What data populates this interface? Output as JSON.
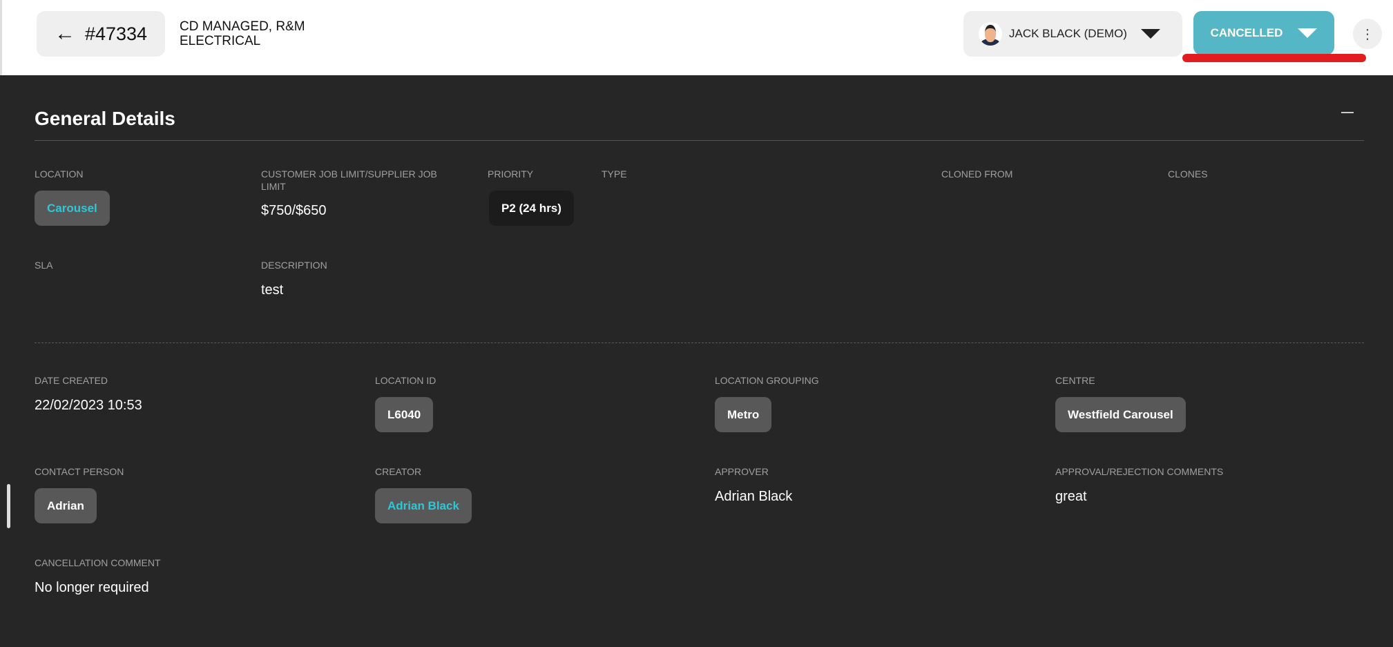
{
  "header": {
    "back_icon": "arrow-left-icon",
    "job_number": "#47334",
    "job_title": "CD MANAGED, R&M ELECTRICAL",
    "user_name": "JACK BLACK (DEMO)",
    "status": "CANCELLED",
    "status_color": "#55b7c5",
    "more_icon": "⋮"
  },
  "section": {
    "title": "General Details",
    "fields": {
      "location": {
        "label": "LOCATION",
        "value": "Carousel"
      },
      "job_limit": {
        "label": "CUSTOMER JOB LIMIT/SUPPLIER JOB LIMIT",
        "value": "$750/$650"
      },
      "priority": {
        "label": "PRIORITY",
        "value": "P2 (24 hrs)"
      },
      "type": {
        "label": "TYPE"
      },
      "cloned_from": {
        "label": "CLONED FROM"
      },
      "clones": {
        "label": "CLONES"
      },
      "sla": {
        "label": "SLA"
      },
      "description": {
        "label": "DESCRIPTION",
        "value": "test"
      },
      "date_created": {
        "label": "DATE CREATED",
        "value": "22/02/2023 10:53"
      },
      "location_id": {
        "label": "LOCATION ID",
        "value": "L6040"
      },
      "location_grouping": {
        "label": "LOCATION GROUPING",
        "value": "Metro"
      },
      "centre": {
        "label": "CENTRE",
        "value": "Westfield Carousel"
      },
      "contact_person": {
        "label": "CONTACT PERSON",
        "value": "Adrian"
      },
      "creator": {
        "label": "CREATOR",
        "value": "Adrian Black"
      },
      "approver": {
        "label": "APPROVER",
        "value": "Adrian Black"
      },
      "approval_comments": {
        "label": "APPROVAL/REJECTION COMMENTS",
        "value": "great"
      },
      "cancellation_comment": {
        "label": "CANCELLATION COMMENT",
        "value": "No longer required"
      }
    }
  }
}
